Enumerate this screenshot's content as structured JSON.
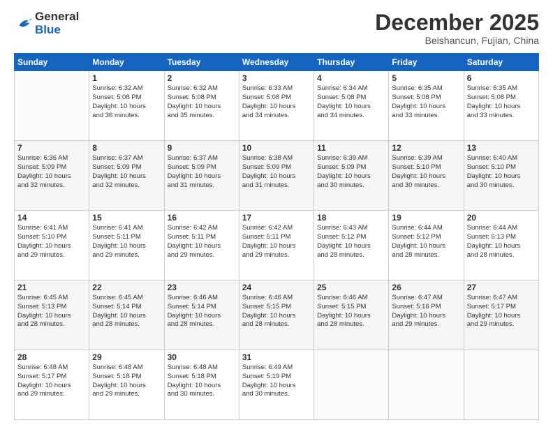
{
  "logo": {
    "line1": "General",
    "line2": "Blue"
  },
  "title": "December 2025",
  "location": "Beishancun, Fujian, China",
  "days_of_week": [
    "Sunday",
    "Monday",
    "Tuesday",
    "Wednesday",
    "Thursday",
    "Friday",
    "Saturday"
  ],
  "weeks": [
    [
      {
        "num": "",
        "info": ""
      },
      {
        "num": "1",
        "info": "Sunrise: 6:32 AM\nSunset: 5:08 PM\nDaylight: 10 hours\nand 36 minutes."
      },
      {
        "num": "2",
        "info": "Sunrise: 6:32 AM\nSunset: 5:08 PM\nDaylight: 10 hours\nand 35 minutes."
      },
      {
        "num": "3",
        "info": "Sunrise: 6:33 AM\nSunset: 5:08 PM\nDaylight: 10 hours\nand 34 minutes."
      },
      {
        "num": "4",
        "info": "Sunrise: 6:34 AM\nSunset: 5:08 PM\nDaylight: 10 hours\nand 34 minutes."
      },
      {
        "num": "5",
        "info": "Sunrise: 6:35 AM\nSunset: 5:08 PM\nDaylight: 10 hours\nand 33 minutes."
      },
      {
        "num": "6",
        "info": "Sunrise: 6:35 AM\nSunset: 5:08 PM\nDaylight: 10 hours\nand 33 minutes."
      }
    ],
    [
      {
        "num": "7",
        "info": "Sunrise: 6:36 AM\nSunset: 5:09 PM\nDaylight: 10 hours\nand 32 minutes."
      },
      {
        "num": "8",
        "info": "Sunrise: 6:37 AM\nSunset: 5:09 PM\nDaylight: 10 hours\nand 32 minutes."
      },
      {
        "num": "9",
        "info": "Sunrise: 6:37 AM\nSunset: 5:09 PM\nDaylight: 10 hours\nand 31 minutes."
      },
      {
        "num": "10",
        "info": "Sunrise: 6:38 AM\nSunset: 5:09 PM\nDaylight: 10 hours\nand 31 minutes."
      },
      {
        "num": "11",
        "info": "Sunrise: 6:39 AM\nSunset: 5:09 PM\nDaylight: 10 hours\nand 30 minutes."
      },
      {
        "num": "12",
        "info": "Sunrise: 6:39 AM\nSunset: 5:10 PM\nDaylight: 10 hours\nand 30 minutes."
      },
      {
        "num": "13",
        "info": "Sunrise: 6:40 AM\nSunset: 5:10 PM\nDaylight: 10 hours\nand 30 minutes."
      }
    ],
    [
      {
        "num": "14",
        "info": "Sunrise: 6:41 AM\nSunset: 5:10 PM\nDaylight: 10 hours\nand 29 minutes."
      },
      {
        "num": "15",
        "info": "Sunrise: 6:41 AM\nSunset: 5:11 PM\nDaylight: 10 hours\nand 29 minutes."
      },
      {
        "num": "16",
        "info": "Sunrise: 6:42 AM\nSunset: 5:11 PM\nDaylight: 10 hours\nand 29 minutes."
      },
      {
        "num": "17",
        "info": "Sunrise: 6:42 AM\nSunset: 5:11 PM\nDaylight: 10 hours\nand 29 minutes."
      },
      {
        "num": "18",
        "info": "Sunrise: 6:43 AM\nSunset: 5:12 PM\nDaylight: 10 hours\nand 28 minutes."
      },
      {
        "num": "19",
        "info": "Sunrise: 6:44 AM\nSunset: 5:12 PM\nDaylight: 10 hours\nand 28 minutes."
      },
      {
        "num": "20",
        "info": "Sunrise: 6:44 AM\nSunset: 5:13 PM\nDaylight: 10 hours\nand 28 minutes."
      }
    ],
    [
      {
        "num": "21",
        "info": "Sunrise: 6:45 AM\nSunset: 5:13 PM\nDaylight: 10 hours\nand 28 minutes."
      },
      {
        "num": "22",
        "info": "Sunrise: 6:45 AM\nSunset: 5:14 PM\nDaylight: 10 hours\nand 28 minutes."
      },
      {
        "num": "23",
        "info": "Sunrise: 6:46 AM\nSunset: 5:14 PM\nDaylight: 10 hours\nand 28 minutes."
      },
      {
        "num": "24",
        "info": "Sunrise: 6:46 AM\nSunset: 5:15 PM\nDaylight: 10 hours\nand 28 minutes."
      },
      {
        "num": "25",
        "info": "Sunrise: 6:46 AM\nSunset: 5:15 PM\nDaylight: 10 hours\nand 28 minutes."
      },
      {
        "num": "26",
        "info": "Sunrise: 6:47 AM\nSunset: 5:16 PM\nDaylight: 10 hours\nand 29 minutes."
      },
      {
        "num": "27",
        "info": "Sunrise: 6:47 AM\nSunset: 5:17 PM\nDaylight: 10 hours\nand 29 minutes."
      }
    ],
    [
      {
        "num": "28",
        "info": "Sunrise: 6:48 AM\nSunset: 5:17 PM\nDaylight: 10 hours\nand 29 minutes."
      },
      {
        "num": "29",
        "info": "Sunrise: 6:48 AM\nSunset: 5:18 PM\nDaylight: 10 hours\nand 29 minutes."
      },
      {
        "num": "30",
        "info": "Sunrise: 6:48 AM\nSunset: 5:18 PM\nDaylight: 10 hours\nand 30 minutes."
      },
      {
        "num": "31",
        "info": "Sunrise: 6:49 AM\nSunset: 5:19 PM\nDaylight: 10 hours\nand 30 minutes."
      },
      {
        "num": "",
        "info": ""
      },
      {
        "num": "",
        "info": ""
      },
      {
        "num": "",
        "info": ""
      }
    ]
  ]
}
